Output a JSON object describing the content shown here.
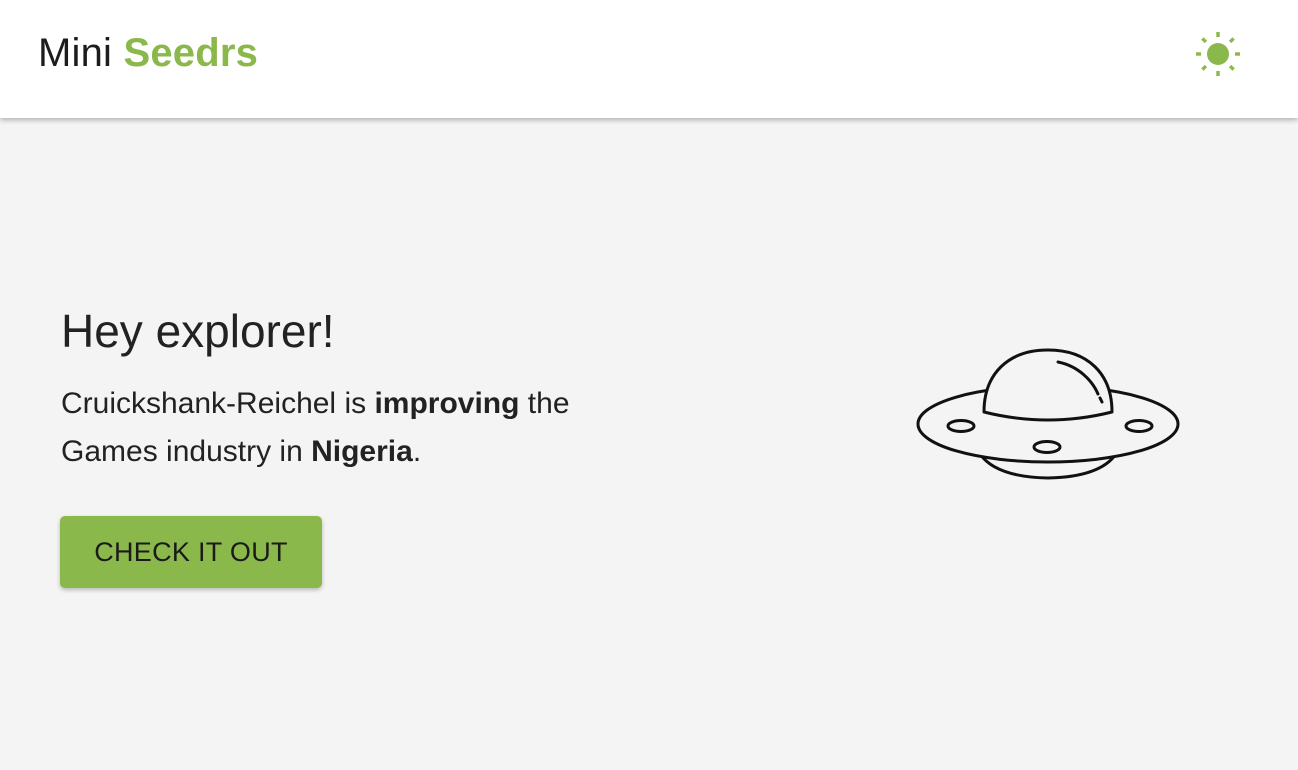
{
  "header": {
    "brand_part1": "Mini",
    "brand_part2": "Seedrs",
    "theme_toggle_icon": "sun-icon"
  },
  "hero": {
    "title": "Hey explorer!",
    "company": "Cruickshank-Reichel",
    "connector1": " is ",
    "verb": "improving",
    "connector2": " the ",
    "industry_line": "Games industry in ",
    "country": "Nigeria",
    "end": ".",
    "cta_label": "CHECK IT OUT",
    "illustration_icon": "ufo-icon"
  },
  "colors": {
    "accent": "#8ab84a",
    "background": "#f4f4f4",
    "header_bg": "#ffffff",
    "text": "#222222"
  }
}
